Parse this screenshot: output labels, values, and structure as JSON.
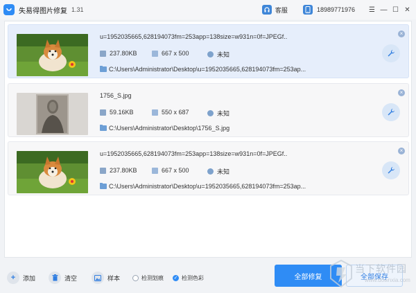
{
  "titlebar": {
    "app_title": "失易得图片修复",
    "version": "1.31",
    "service_label": "客服",
    "phone": "18989771976",
    "menu_glyph": "☰",
    "minimize_glyph": "—",
    "maximize_glyph": "☐",
    "close_glyph": "✕"
  },
  "files": [
    {
      "name": "u=1952035665,628194073fm=253app=138size=w931n=0f=JPEGf...",
      "size": "237.80KB",
      "dimensions": "667 x 500",
      "status": "未知",
      "path": "C:\\Users\\Administrator\\Desktop\\u=1952035665,628194073fm=253ap...",
      "thumb": "corgi-photo",
      "selected": true
    },
    {
      "name": "1756_S.jpg",
      "size": "59.16KB",
      "dimensions": "550 x 687",
      "status": "未知",
      "path": "C:\\Users\\Administrator\\Desktop\\1756_S.jpg",
      "thumb": "old-portrait-photo",
      "selected": false
    },
    {
      "name": "u=1952035665,628194073fm=253app=138size=w931n=0f=JPEGf...",
      "size": "237.80KB",
      "dimensions": "667 x 500",
      "status": "未知",
      "path": "C:\\Users\\Administrator\\Desktop\\u=1952035665,628194073fm=253ap...",
      "thumb": "corgi-photo",
      "selected": false
    }
  ],
  "bottombar": {
    "add_label": "添加",
    "clear_label": "清空",
    "sample_label": "样本",
    "detect_scratch_label": "检测划痕",
    "detect_scratch_checked": false,
    "detect_color_label": "检测色彩",
    "detect_color_checked": true,
    "repair_all_label": "全部修复",
    "save_all_label": "全部保存"
  },
  "watermark": {
    "text": "当下软件园",
    "url": "www.downxia.com"
  },
  "colors": {
    "accent": "#2f8cf5",
    "selected_card": "#e6eefb"
  }
}
